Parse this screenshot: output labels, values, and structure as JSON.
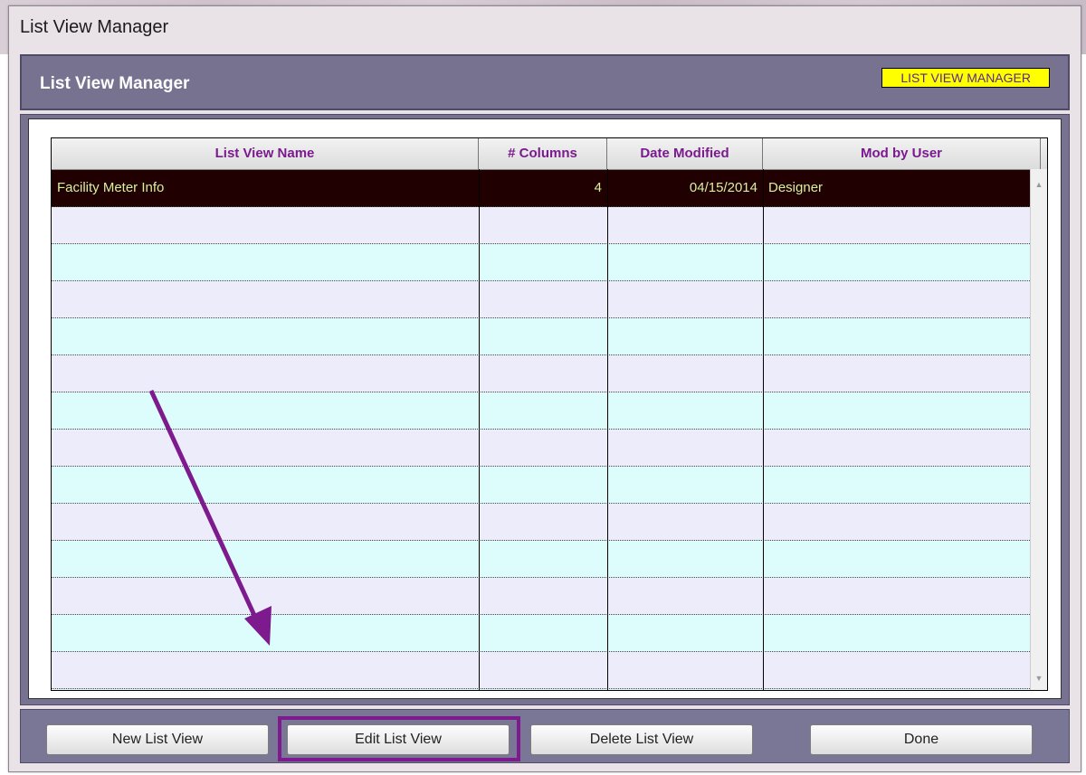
{
  "window": {
    "title": "List View Manager"
  },
  "header": {
    "title": "List View Manager",
    "badge": "LIST VIEW MANAGER"
  },
  "table": {
    "columns": [
      "List View Name",
      "# Columns",
      "Date Modified",
      "Mod by User"
    ],
    "rows": [
      {
        "name": "Facility Meter Info",
        "columns": "4",
        "date": "04/15/2014",
        "user": "Designer"
      }
    ]
  },
  "buttons": {
    "new": "New List View",
    "edit": "Edit List View",
    "delete": "Delete List View",
    "done": "Done"
  },
  "colors": {
    "header_bar": "#76728f",
    "header_text": "#7a1a8e",
    "badge": "#ffff00",
    "selected_row": "#200000",
    "annotation": "#7c1a8e"
  },
  "icons": {
    "scroll_up": "scroll-up-icon",
    "scroll_down": "scroll-down-icon",
    "arrow": "annotation-arrow"
  }
}
